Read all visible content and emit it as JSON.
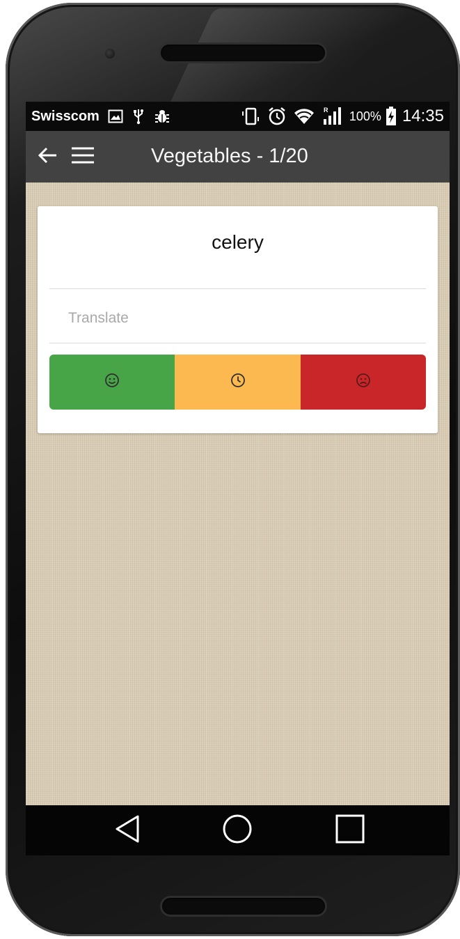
{
  "status_bar": {
    "carrier": "Swisscom",
    "battery": "100%",
    "time": "14:35",
    "icons": [
      "image-notification-icon",
      "usb-icon",
      "bug-icon",
      "vibrate-icon",
      "alarm-icon",
      "wifi-icon",
      "signal-icon",
      "battery-charging-icon"
    ]
  },
  "toolbar": {
    "title": "Vegetables - 1/20",
    "icons": [
      "back-arrow-icon",
      "menu-icon"
    ]
  },
  "card": {
    "word": "celery",
    "translate_placeholder": "Translate",
    "translate_value": "",
    "buttons": [
      {
        "name": "know",
        "icon": "smile-icon",
        "color": "#47a447"
      },
      {
        "name": "later",
        "icon": "clock-icon",
        "color": "#fbb950"
      },
      {
        "name": "dont-know",
        "icon": "frown-icon",
        "color": "#c9262a"
      }
    ]
  },
  "nav_bar": {
    "icons": [
      "back-triangle-icon",
      "home-circle-icon",
      "recents-square-icon"
    ]
  },
  "colors": {
    "toolbar": "#424242",
    "status_bar": "#0a0a0a",
    "background": "#d8ccb5"
  }
}
